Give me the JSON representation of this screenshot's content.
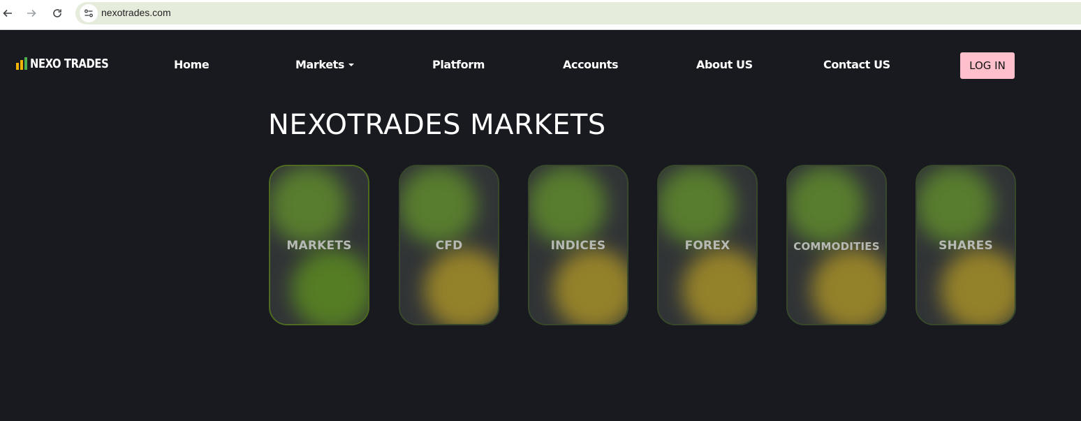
{
  "browser": {
    "url": "nexotrades.com"
  },
  "header": {
    "logo_text": "NEXO TRADES",
    "nav": [
      {
        "label": "Home"
      },
      {
        "label": "Markets"
      },
      {
        "label": "Platform"
      },
      {
        "label": "Accounts"
      },
      {
        "label": "About US"
      },
      {
        "label": "Contact US"
      }
    ],
    "login_label": "LOG IN"
  },
  "main": {
    "title": "NEXOTRADES MARKETS",
    "cards": [
      {
        "label": "MARKETS"
      },
      {
        "label": "CFD"
      },
      {
        "label": "INDICES"
      },
      {
        "label": "FOREX"
      },
      {
        "label": "COMMODITIES"
      },
      {
        "label": "SHARES"
      }
    ]
  },
  "colors": {
    "page_bg": "#181a1f",
    "login_bg": "#ffc0cb",
    "card_green": "#5e8a2a",
    "card_yellow": "#a89025",
    "logo_yellow": "#f0b400",
    "logo_green": "#4caf50"
  },
  "icons": [
    "back-arrow-icon",
    "forward-arrow-icon",
    "reload-icon",
    "site-info-icon",
    "logo-bars-icon",
    "dropdown-caret-icon"
  ]
}
